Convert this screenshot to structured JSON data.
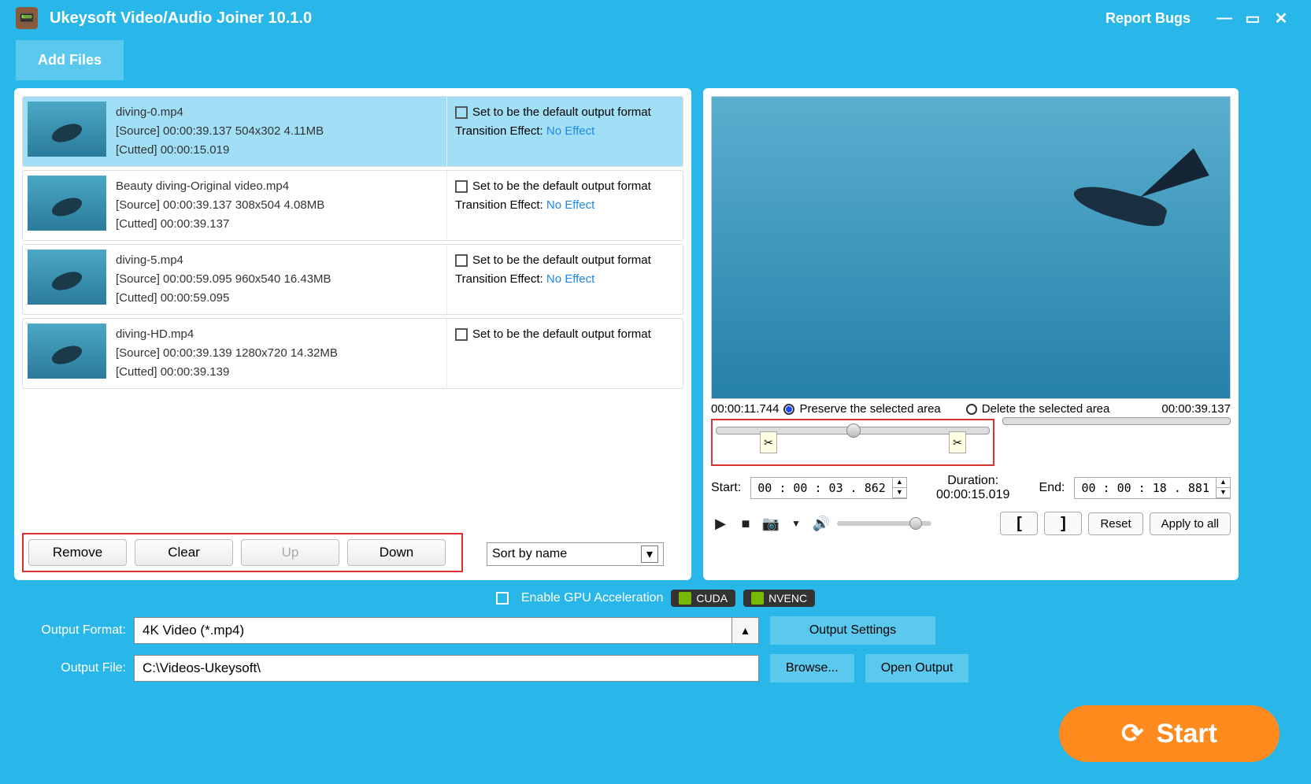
{
  "titlebar": {
    "app_title": "Ukeysoft Video/Audio Joiner 10.1.0",
    "report_bugs": "Report Bugs"
  },
  "toolbar": {
    "add_files": "Add Files"
  },
  "files": [
    {
      "name": "diving-0.mp4",
      "source": "[Source]  00:00:39.137  504x302  4.11MB",
      "cut": "[Cutted]   00:00:15.019",
      "default_label": "Set to be the default output format",
      "te_label": "Transition Effect:",
      "te_value": "No Effect",
      "selected": true,
      "show_te": true
    },
    {
      "name": "Beauty diving-Original video.mp4",
      "source": "[Source]  00:00:39.137  308x504  4.08MB",
      "cut": "[Cutted]   00:00:39.137",
      "default_label": "Set to be the default output format",
      "te_label": "Transition Effect:",
      "te_value": "No Effect",
      "selected": false,
      "show_te": true
    },
    {
      "name": "diving-5.mp4",
      "source": "[Source]  00:00:59.095  960x540  16.43MB",
      "cut": "[Cutted]   00:00:59.095",
      "default_label": "Set to be the default output format",
      "te_label": "Transition Effect:",
      "te_value": "No Effect",
      "selected": false,
      "show_te": true
    },
    {
      "name": "diving-HD.mp4",
      "source": "[Source]  00:00:39.139  1280x720  14.32MB",
      "cut": "[Cutted]   00:00:39.139",
      "default_label": "Set to be the default output format",
      "te_label": "",
      "te_value": "",
      "selected": false,
      "show_te": false
    }
  ],
  "list_actions": {
    "remove": "Remove",
    "clear": "Clear",
    "up": "Up",
    "down": "Down",
    "sort": "Sort by name"
  },
  "preview": {
    "pos": "00:00:11.744",
    "preserve": "Preserve the selected area",
    "delete": "Delete the selected area",
    "total": "00:00:39.137",
    "start_lbl": "Start:",
    "start_val": "00 : 00 : 03 . 862",
    "duration_lbl": "Duration: ",
    "duration_val": "00:00:15.019",
    "end_lbl": "End:",
    "end_val": "00 : 00 : 18 . 881",
    "reset": "Reset",
    "apply": "Apply to all"
  },
  "bottom": {
    "gpu_lbl": "Enable GPU Acceleration",
    "cuda": "CUDA",
    "nvenc": "NVENC",
    "fmt_lbl": "Output Format:",
    "fmt_val": "4K Video (*.mp4)",
    "settings": "Output Settings",
    "file_lbl": "Output File:",
    "file_val": "C:\\Videos-Ukeysoft\\",
    "browse": "Browse...",
    "open": "Open Output",
    "start": "Start"
  }
}
